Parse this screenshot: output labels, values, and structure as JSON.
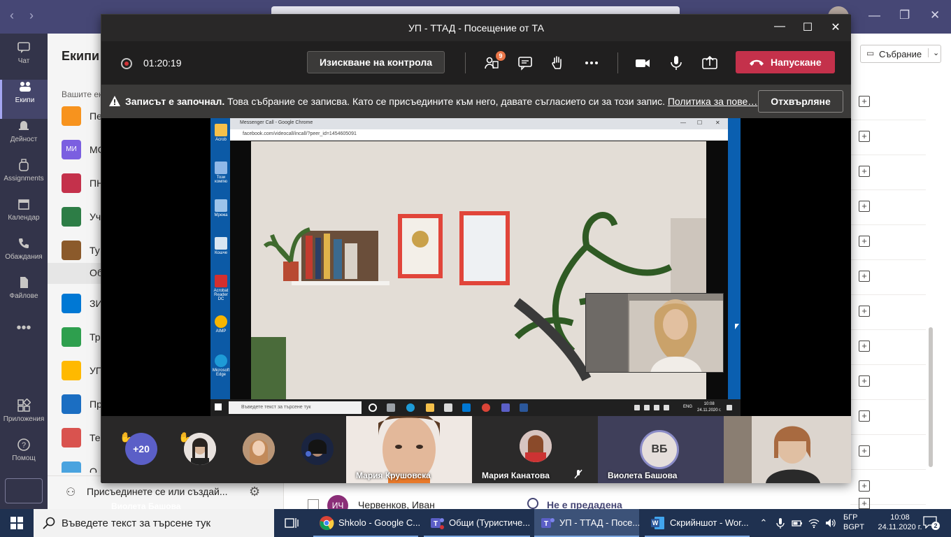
{
  "teams_app": {
    "rail": [
      {
        "label": "Чат",
        "icon": "chat-icon"
      },
      {
        "label": "Екипи",
        "icon": "teams-icon",
        "active": true
      },
      {
        "label": "Дейност",
        "icon": "bell-icon"
      },
      {
        "label": "Assignments",
        "icon": "backpack-icon"
      },
      {
        "label": "Календар",
        "icon": "calendar-icon"
      },
      {
        "label": "Обаждания",
        "icon": "phone-icon"
      },
      {
        "label": "Файлове",
        "icon": "file-icon"
      },
      {
        "label": "Приложения",
        "icon": "apps-icon"
      },
      {
        "label": "Помощ",
        "icon": "help-icon"
      }
    ],
    "more": "•••",
    "panel_title": "Екипи",
    "panel_subtitle": "Вашите ек",
    "teams": [
      {
        "name": "Пе",
        "color": "#f7931e"
      },
      {
        "name": "МС",
        "color": "#7b5fe0",
        "abbr": "МИ"
      },
      {
        "name": "ПН",
        "color": "#c4314b"
      },
      {
        "name": "Уч",
        "color": "#2d7d46"
      },
      {
        "name": "Ту",
        "color": "#8b5a2b"
      }
    ],
    "selected_channel": "Об",
    "teams_after": [
      {
        "name": "ЗИ",
        "color": "#0078d4"
      },
      {
        "name": "Тр",
        "color": "#2e9f4e"
      },
      {
        "name": "УП",
        "color": "#ffb900"
      },
      {
        "name": "Пр",
        "color": "#1b6ec2"
      },
      {
        "name": "Те",
        "color": "#d9534f"
      },
      {
        "name": "О",
        "color": "#4aa3df"
      }
    ],
    "join_team": "Присъединете се или създай...",
    "meeting_button": "Събрание",
    "bottom_row": {
      "initials": "ИЧ",
      "name": "Червенков, Иван",
      "status": "Не е предадена"
    }
  },
  "meeting": {
    "title": "УП - ТТАД - Посещение от ТА",
    "timer": "01:20:19",
    "request_control": "Изискване на контрола",
    "participants_count": "9",
    "leave": "Напускане",
    "recording_banner": {
      "bold": "Записът е започнал.",
      "text": "Това събрание се записва. Като се присъедините към него, давате съгласието си за този запис.",
      "link": "Политика за пове…",
      "dismiss": "Отхвърляне"
    },
    "presenter": "Виолета Башова",
    "shared_screen": {
      "window_title": "Messenger Call - Google Chrome",
      "url": "facebook.com/videocall/incall/?peer_id=1454605091",
      "search_placeholder": "Въведете текст за търсене тук",
      "lang": "ENG",
      "time": "10:08",
      "date": "24.11.2020 г.",
      "desktop_icons": [
        "Acrob",
        "Този компю",
        "Мрежа",
        "Кошче",
        "Acrobat Reader DC",
        "AIMP",
        "Microsoft Edge"
      ]
    },
    "gallery": {
      "overflow": "+20",
      "tiles": [
        {
          "name": "Мария Крушовска"
        },
        {
          "name": "Мария Канатова"
        },
        {
          "name": "Виолета Башова",
          "initials": "ВБ"
        }
      ]
    }
  },
  "taskbar": {
    "search_placeholder": "Въведете текст за търсене тук",
    "apps": [
      {
        "label": "Shkolo - Google C...",
        "color": "#db4437"
      },
      {
        "label": "Общи (Туристиче...",
        "color": "#5b5fc7"
      },
      {
        "label": "УП - ТТАД - Посе...",
        "color": "#5b5fc7"
      },
      {
        "label": "Скрийншот - Wor...",
        "color": "#2b579a"
      }
    ],
    "lang_line1": "БГР",
    "lang_line2": "BGPT",
    "time": "10:08",
    "date": "24.11.2020 г.",
    "notifications": "2"
  }
}
